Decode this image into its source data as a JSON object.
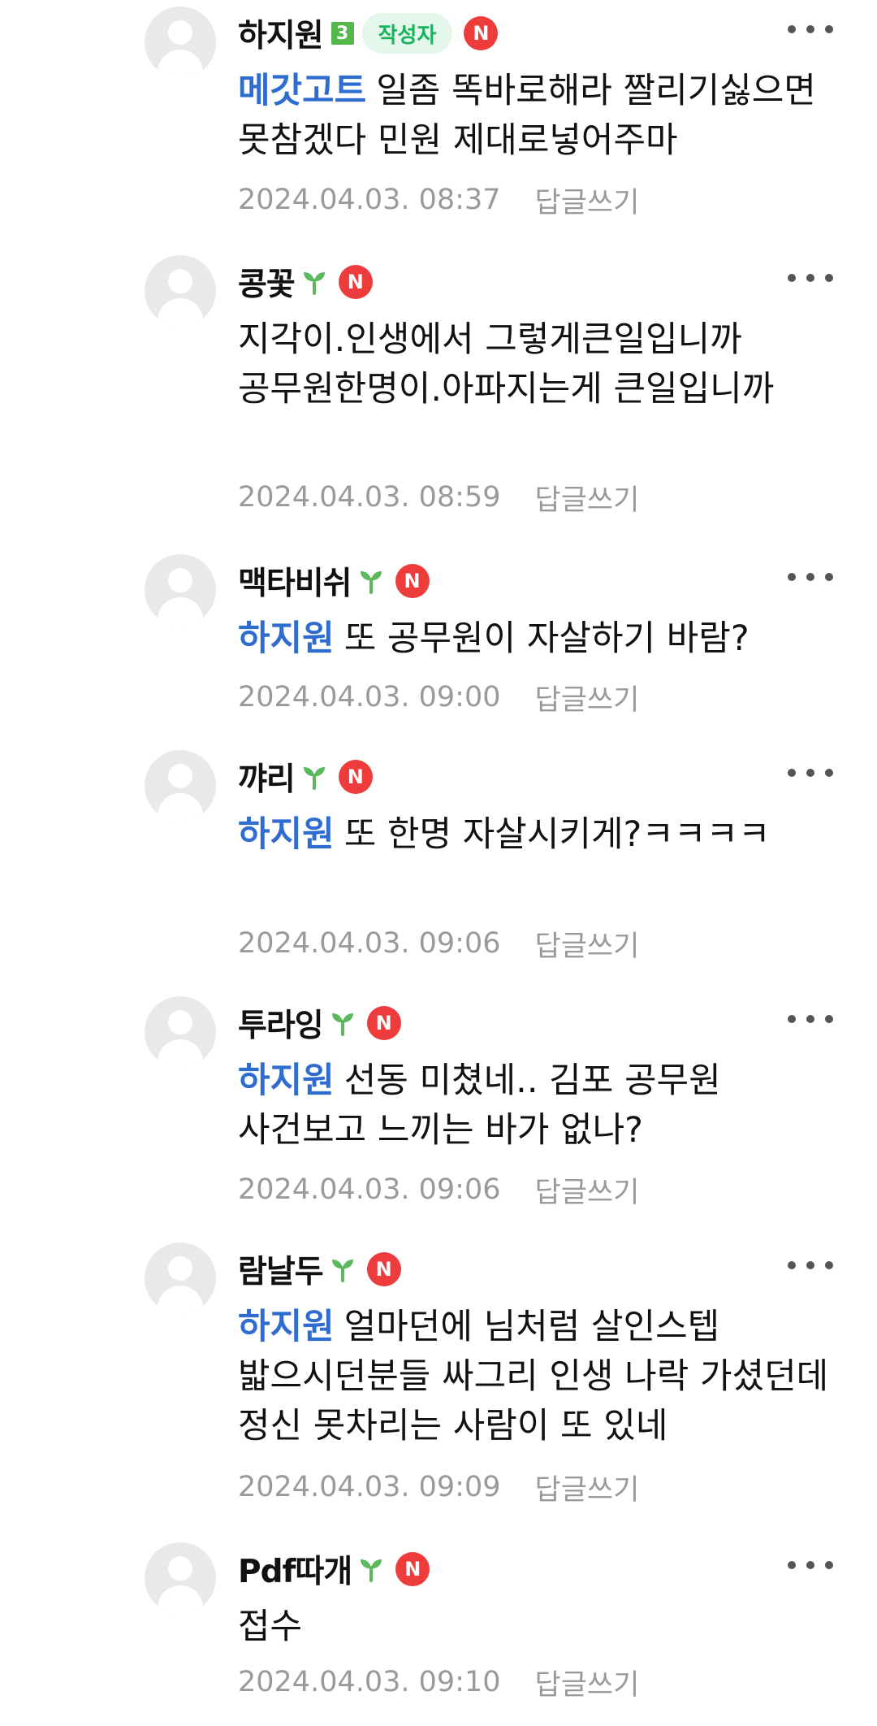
{
  "comments": [
    {
      "nickname": "하지원",
      "level": "3",
      "writer_badge": "작성자",
      "n_badge": "N",
      "mention": "메갓고트",
      "text": "일좀 똑바로해라 짤리기싫으면 못참겠다 민원 제대로넣어주마",
      "date": "2024.04.03. 08:37",
      "reply_label": "답글쓰기"
    },
    {
      "nickname": "콩꽃",
      "n_badge": "N",
      "text": "지각이.인생에서 그렇게큰일입니까 공무원한명이.아파지는게 큰일입니까",
      "date": "2024.04.03. 08:59",
      "reply_label": "답글쓰기"
    },
    {
      "nickname": "맥타비쉬",
      "n_badge": "N",
      "mention": "하지원",
      "text": "또 공무원이 자살하기 바람?",
      "date": "2024.04.03. 09:00",
      "reply_label": "답글쓰기"
    },
    {
      "nickname": "꺄리",
      "n_badge": "N",
      "mention": "하지원",
      "text": "또 한명 자살시키게?ㅋㅋㅋㅋ",
      "date": "2024.04.03. 09:06",
      "reply_label": "답글쓰기"
    },
    {
      "nickname": "투라잉",
      "n_badge": "N",
      "mention": "하지원",
      "text": "선동 미쳤네.. 김포 공무원 사건보고 느끼는 바가 없나?",
      "date": "2024.04.03. 09:06",
      "reply_label": "답글쓰기"
    },
    {
      "nickname": "람날두",
      "n_badge": "N",
      "mention": "하지원",
      "text": "얼마던에 님처럼 살인스텝 밟으시던분들 싸그리 인생 나락 가셨던데 정신 못차리는 사람이 또 있네",
      "date": "2024.04.03. 09:09",
      "reply_label": "답글쓰기"
    },
    {
      "nickname": "Pdf따개",
      "n_badge": "N",
      "text": "접수",
      "date": "2024.04.03. 09:10",
      "reply_label": "답글쓰기"
    }
  ],
  "colors": {
    "mention": "#2f6cd0",
    "n_badge": "#ee3c3c",
    "writer_badge_bg": "#e5f6ec",
    "writer_badge_text": "#19b35a",
    "sprout": "#5cb85c",
    "meta": "#9a9a9a"
  },
  "icons": {
    "sprout": "sprout-icon",
    "more": "more-options-icon",
    "avatar": "default-avatar-icon"
  }
}
